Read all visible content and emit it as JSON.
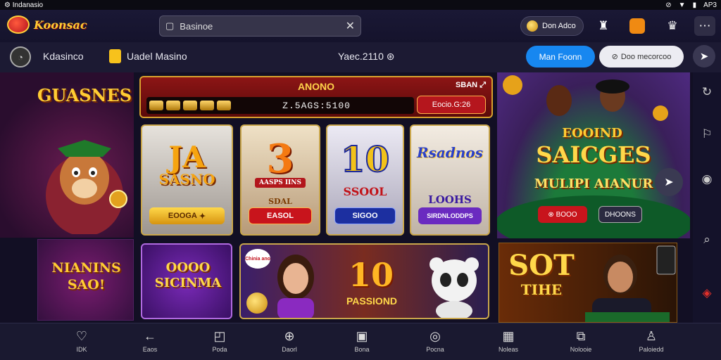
{
  "status": {
    "left": "Indanasio",
    "right": "AP3"
  },
  "brand": {
    "logo_text": "Koonsac"
  },
  "search": {
    "value": "Basinoe"
  },
  "header": {
    "coin_label": "Don Adco"
  },
  "subbar": {
    "account_name": "Kdasinco",
    "casino_label": "Uadel Masino",
    "balance": "Yaec.2110"
  },
  "actions": {
    "primary": "Man Foonn",
    "secondary": "Doo mecorcoo"
  },
  "left_top": {
    "title": "GUASNES"
  },
  "left_bot": {
    "title": "NIANINS SAO!"
  },
  "jackpot": {
    "title": "ANONO",
    "corner": "SBAN",
    "value": "Z.5AGS:5100",
    "button": "Eocio.G:26"
  },
  "cards": [
    {
      "big": "JA",
      "sub": "SASNO",
      "button": "EOOGA"
    },
    {
      "big": "3",
      "sub": "AASPS IINS",
      "mid": "SDAL",
      "button": "EASOL"
    },
    {
      "big": "10",
      "sub": "SSOOL",
      "button": "SIGOO"
    },
    {
      "big": "Rsadnos",
      "sub": "LOOHS",
      "button": "SIRDNLODDPS"
    }
  ],
  "bottom_cards": [
    {
      "title": "OOOO SICINMA"
    },
    {
      "badge": "Chinia ano",
      "big": "10",
      "sub": "PASSIOND"
    }
  ],
  "right_top": {
    "title1": "EOOIND",
    "title2": "SAICGES",
    "title3": "MULIPI AIANUR",
    "btn1": "BOOO",
    "btn2": "DHOONS"
  },
  "right_bot": {
    "title": "SOT",
    "sub": "TIHE"
  },
  "bottom_nav": [
    {
      "label": "IDK"
    },
    {
      "label": "Eaos"
    },
    {
      "label": "Poda"
    },
    {
      "label": "Daorl"
    },
    {
      "label": "Bona"
    },
    {
      "label": "Pocna"
    },
    {
      "label": "Noleas"
    },
    {
      "label": "Nolooie"
    },
    {
      "label": "Paloiedd"
    }
  ]
}
